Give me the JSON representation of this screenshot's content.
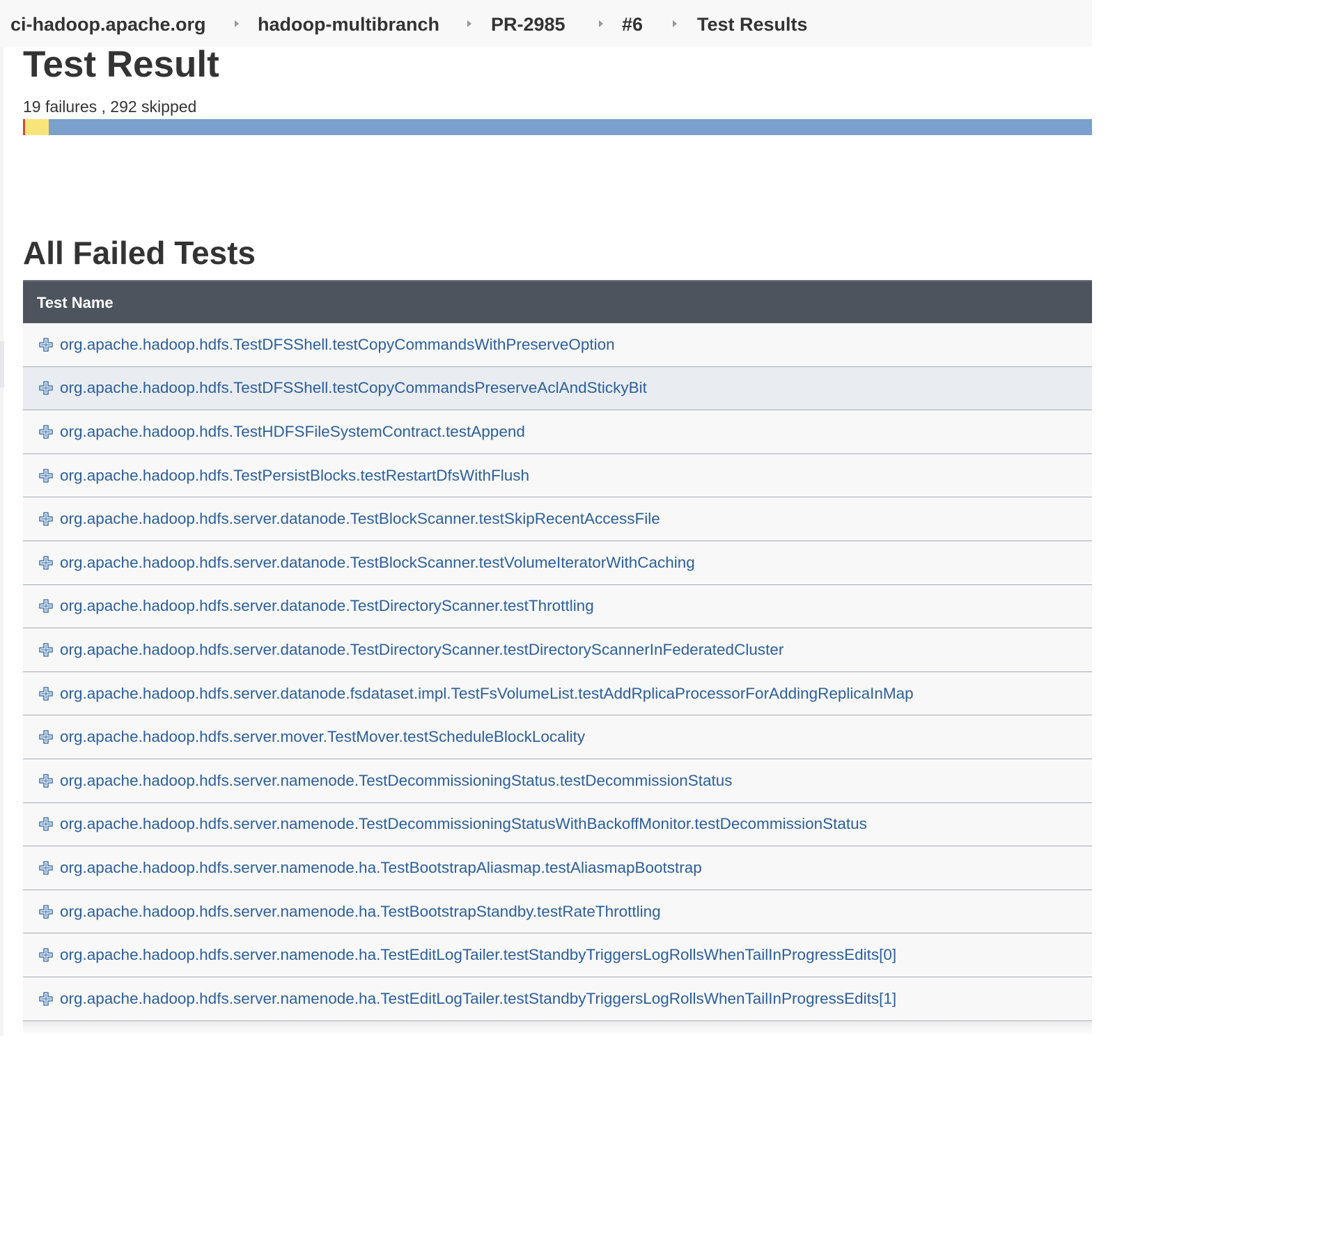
{
  "breadcrumb": {
    "items": [
      "ci-hadoop.apache.org",
      "hadoop-multibranch",
      "PR-2985",
      "#6",
      "Test Results"
    ]
  },
  "page": {
    "title": "Test Result",
    "summary": "19 failures , 292 skipped"
  },
  "result_bar": {
    "fail_fraction": 0.002,
    "skip_fraction": 0.022,
    "colors": {
      "fail": "#d24939",
      "skip": "#f8e479",
      "pass": "#7ba0cd"
    }
  },
  "failed_tests": {
    "title": "All Failed Tests",
    "column_header": "Test Name",
    "rows": [
      "org.apache.hadoop.hdfs.TestDFSShell.testCopyCommandsWithPreserveOption",
      "org.apache.hadoop.hdfs.TestDFSShell.testCopyCommandsPreserveAclAndStickyBit",
      "org.apache.hadoop.hdfs.TestHDFSFileSystemContract.testAppend",
      "org.apache.hadoop.hdfs.TestPersistBlocks.testRestartDfsWithFlush",
      "org.apache.hadoop.hdfs.server.datanode.TestBlockScanner.testSkipRecentAccessFile",
      "org.apache.hadoop.hdfs.server.datanode.TestBlockScanner.testVolumeIteratorWithCaching",
      "org.apache.hadoop.hdfs.server.datanode.TestDirectoryScanner.testThrottling",
      "org.apache.hadoop.hdfs.server.datanode.TestDirectoryScanner.testDirectoryScannerInFederatedCluster",
      "org.apache.hadoop.hdfs.server.datanode.fsdataset.impl.TestFsVolumeList.testAddRplicaProcessorForAddingReplicaInMap",
      "org.apache.hadoop.hdfs.server.mover.TestMover.testScheduleBlockLocality",
      "org.apache.hadoop.hdfs.server.namenode.TestDecommissioningStatus.testDecommissionStatus",
      "org.apache.hadoop.hdfs.server.namenode.TestDecommissioningStatusWithBackoffMonitor.testDecommissionStatus",
      "org.apache.hadoop.hdfs.server.namenode.ha.TestBootstrapAliasmap.testAliasmapBootstrap",
      "org.apache.hadoop.hdfs.server.namenode.ha.TestBootstrapStandby.testRateThrottling",
      "org.apache.hadoop.hdfs.server.namenode.ha.TestEditLogTailer.testStandbyTriggersLogRollsWhenTailInProgressEdits[0]",
      "org.apache.hadoop.hdfs.server.namenode.ha.TestEditLogTailer.testStandbyTriggersLogRollsWhenTailInProgressEdits[1]"
    ],
    "hovered_row": 1,
    "row_icon": "expand-plus-icon",
    "link_color": "#2c5f9b"
  }
}
